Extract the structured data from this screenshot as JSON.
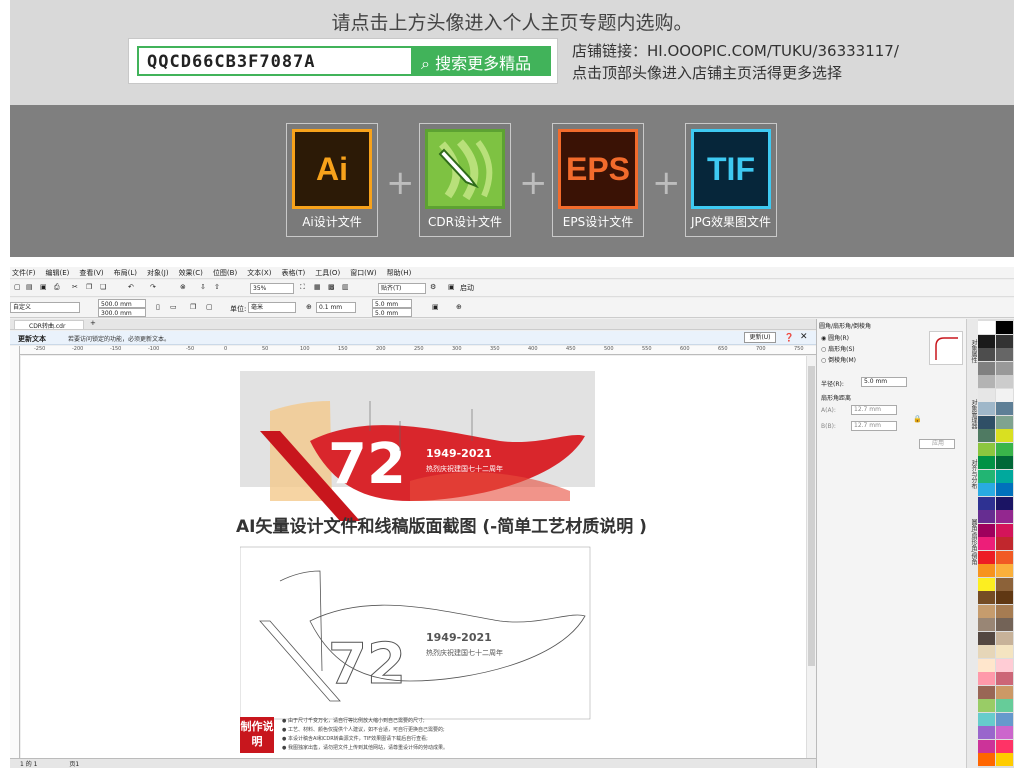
{
  "banner": {
    "title": "请点击上方头像进入个人主页专题内选购。",
    "code": "QQCD66CB3F7087A",
    "search_button": "搜索更多精品",
    "shop_link": "店铺链接：HI.OOOPIC.COM/TUKU/36333117/",
    "shop_hint": "点击顶部头像进入店铺主页活得更多选择"
  },
  "formats": [
    {
      "icon_text": "Ai",
      "label": "Ai设计文件",
      "bg": "#2c1a06",
      "fg": "#f7a21b",
      "border": "#f7a21b"
    },
    {
      "icon_text": "",
      "label": "CDR设计文件",
      "bg": "#7ec242",
      "fg": "#ffffff",
      "border": "#5da232"
    },
    {
      "icon_text": "EPS",
      "label": "EPS设计文件",
      "bg": "#3a1205",
      "fg": "#f26b2c",
      "border": "#f26b2c"
    },
    {
      "icon_text": "TIF",
      "label": "JPG效果图文件",
      "bg": "#06263a",
      "fg": "#3ecaf2",
      "border": "#3ecaf2"
    }
  ],
  "plus_sign": "+",
  "app": {
    "menu": [
      "文件(F)",
      "编辑(E)",
      "查看(V)",
      "布局(L)",
      "对象(J)",
      "效果(C)",
      "位图(B)",
      "文本(X)",
      "表格(T)",
      "工具(O)",
      "窗口(W)",
      "帮助(H)"
    ],
    "zoom": "35%",
    "snap_label": "贴齐(T)",
    "launch_label": "启动",
    "page_size": "自定义",
    "width": "500.0 mm",
    "height": "300.0 mm",
    "unit_label": "单位:",
    "unit": "毫米",
    "nudge": "0.1 mm",
    "dup_x": "5.0 mm",
    "dup_y": "5.0 mm",
    "doc_tab": "CDR转曲.cdr",
    "notice_title": "更新文本",
    "notice_text": "若要访问锁定的功能，必须更新文本。",
    "update_button": "更新(U)",
    "ruler_ticks": [
      "-250",
      "-200",
      "-150",
      "-100",
      "-50",
      "0",
      "50",
      "100",
      "150",
      "200",
      "250",
      "300",
      "350",
      "400",
      "450",
      "500",
      "550",
      "600",
      "650",
      "700",
      "750"
    ],
    "status": "1 的 1",
    "page_label": "页1"
  },
  "panel": {
    "header": "圆角/扇形角/倒棱角",
    "options": [
      "圆角(R)",
      "扇形角(S)",
      "倒棱角(M)"
    ],
    "radius_label": "半径(R):",
    "radius_value": "5.0 mm",
    "dist_label": "扇形角距离",
    "a_label": "A(A):",
    "a_value": "12.7 mm",
    "b_label": "B(B):",
    "b_value": "12.7 mm",
    "apply_button": "应用",
    "side_tabs": [
      "对象属性",
      "对象管理器",
      "对齐与分布",
      "圆角/扇形角/倒角"
    ]
  },
  "palette": [
    "#ffffff",
    "#000000",
    "#1a1a1a",
    "#333333",
    "#4d4d4d",
    "#666666",
    "#808080",
    "#999999",
    "#b3b3b3",
    "#cccccc",
    "#e6e6e6",
    "#f2f2f2",
    "#9fb7c9",
    "#5e7f96",
    "#2f4f66",
    "#7fa38f",
    "#4f7a62",
    "#d9e021",
    "#8cc63f",
    "#39b54a",
    "#009245",
    "#006837",
    "#22b573",
    "#00a99d",
    "#29abe2",
    "#0071bc",
    "#2e3192",
    "#1b1464",
    "#662d91",
    "#93278f",
    "#9e005d",
    "#d4145a",
    "#ed1e79",
    "#c1272d",
    "#ed1c24",
    "#f15a24",
    "#f7931e",
    "#fbb03b",
    "#fcee21",
    "#8c6239",
    "#754c24",
    "#603813",
    "#c69c6d",
    "#a67c52",
    "#998675",
    "#736357",
    "#534741",
    "#c7b299",
    "#e6d6b8",
    "#f4e4c1",
    "#ffe6cc",
    "#ffccd5",
    "#ff99aa",
    "#cc6677",
    "#996655",
    "#cc9966",
    "#99cc66",
    "#66cc99",
    "#66cccc",
    "#6699cc",
    "#9966cc",
    "#cc66cc",
    "#cc3399",
    "#ff3366",
    "#ff6600",
    "#ffcc00"
  ],
  "artwork": {
    "year": "1949-2021",
    "slogan": "热烈庆祝建国七十二周年",
    "number": "72",
    "caption": "AI矢量设计文件和线稿版面截图 (-简单工艺材质说明 )",
    "note_tag": "制作说明",
    "notes": [
      "● 由于尺寸千变万化，请自行等比例放大缩小到自己需要的尺寸;",
      "● 工艺、材料、颜色仅提供个人建议，如不合适，可自行更换自己需要的;",
      "● 本设计稿含AI和CDR转曲源文件，TIF效果图请下载后自行查看;",
      "● 我图独家出售，请勿把文件上传到其他网站，请尊重设计师的劳动成果。"
    ]
  }
}
